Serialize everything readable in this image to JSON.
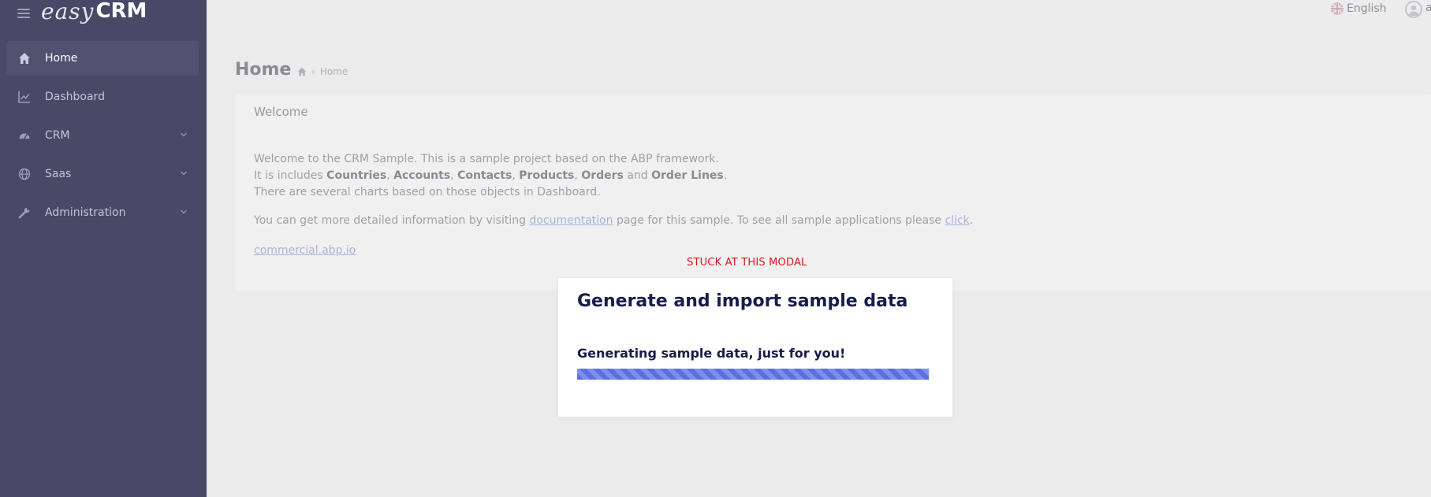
{
  "brand": {
    "part1": "easy",
    "part2": "CRM"
  },
  "sidebar": {
    "items": [
      {
        "label": "Home",
        "icon": "home-icon",
        "active": true
      },
      {
        "label": "Dashboard",
        "icon": "chart-line-icon"
      },
      {
        "label": "CRM",
        "icon": "tachometer-icon",
        "has_children": true
      },
      {
        "label": "Saas",
        "icon": "globe-icon",
        "has_children": true
      },
      {
        "label": "Administration",
        "icon": "wrench-icon",
        "has_children": true
      }
    ]
  },
  "topbar": {
    "language": "English",
    "user_initial": "a"
  },
  "page": {
    "title": "Home",
    "breadcrumb": [
      "Home"
    ]
  },
  "welcome": {
    "heading": "Welcome",
    "line1": "Welcome to the CRM Sample. This is a sample project based on the ABP framework.",
    "line2_prefix": "It is includes ",
    "entities": [
      "Countries",
      "Accounts",
      "Contacts",
      "Products",
      "Orders",
      "Order Lines"
    ],
    "comma": ", ",
    "and": " and ",
    "period": ".",
    "line3": "There are several charts based on those objects in Dashboard.",
    "line4_a": "You can get more detailed information by visiting ",
    "link_documentation": "documentation",
    "line4_b": " page for this sample. To see all sample applications please ",
    "link_click": "click",
    "link_commercial": "commercial.abp.io"
  },
  "annotation": "STUCK AT THIS MODAL",
  "modal": {
    "title": "Generate and import sample data",
    "message": "Generating sample data, just for you!",
    "progress": 1.0
  },
  "colors": {
    "sidebar": "#454a66",
    "accent": "#5a6fe0",
    "annotation": "#e0161d",
    "modal_text": "#171d4a"
  }
}
